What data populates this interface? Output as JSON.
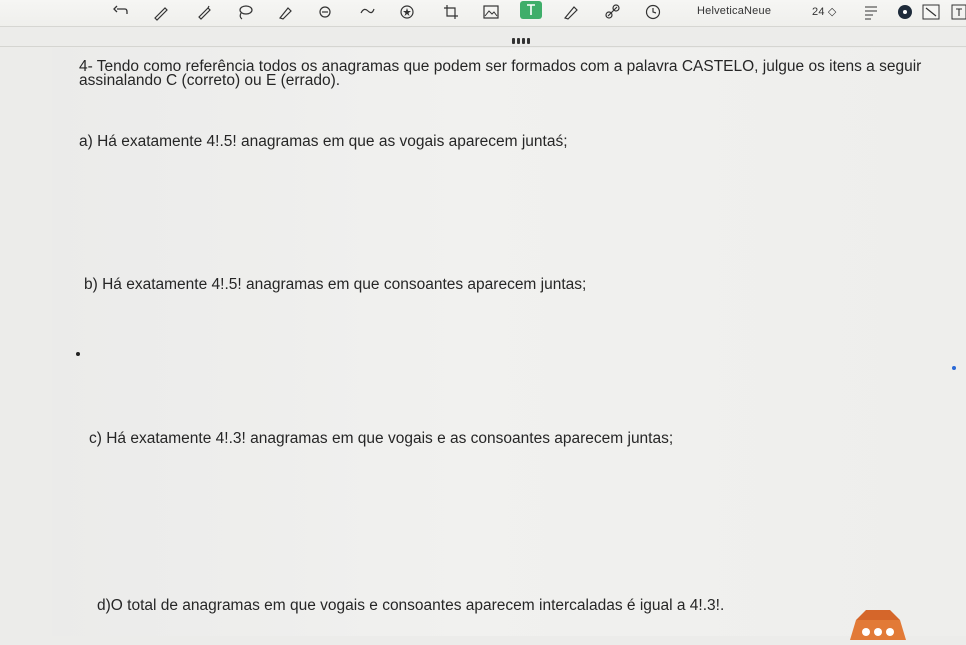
{
  "toolbar": {
    "icons": [
      "undo-icon",
      "pen-icon",
      "pencil-icon",
      "lasso-icon",
      "marker-icon",
      "eraser-icon",
      "shape-icon",
      "star-icon",
      "crop-icon",
      "image-icon",
      "text-icon",
      "highlighter-icon",
      "link-icon",
      "clock-icon"
    ],
    "font_name": "HelveticaNeue",
    "font_size": "24 ◇",
    "accent_color": "#3fae6a"
  },
  "question": {
    "intro_line1": "4- Tendo como referência todos os anagramas que podem ser formados com a palavra CASTELO, julgue os itens a seguir",
    "intro_line2": "assinalando C (correto) ou E (errado).",
    "items": [
      {
        "text": "a) Há exatamente 4!.5! anagramas em que as vogais aparecem juntaś;"
      },
      {
        "text": "b) Há exatamente 4!.5! anagramas em que consoantes aparecem juntas;"
      },
      {
        "text": "c) Há exatamente 4!.3! anagramas em que vogais e as consoantes aparecem juntas;"
      },
      {
        "text": "d)O total de anagramas em que vogais e consoantes aparecem intercaladas é igual a 4!.3!."
      }
    ]
  }
}
